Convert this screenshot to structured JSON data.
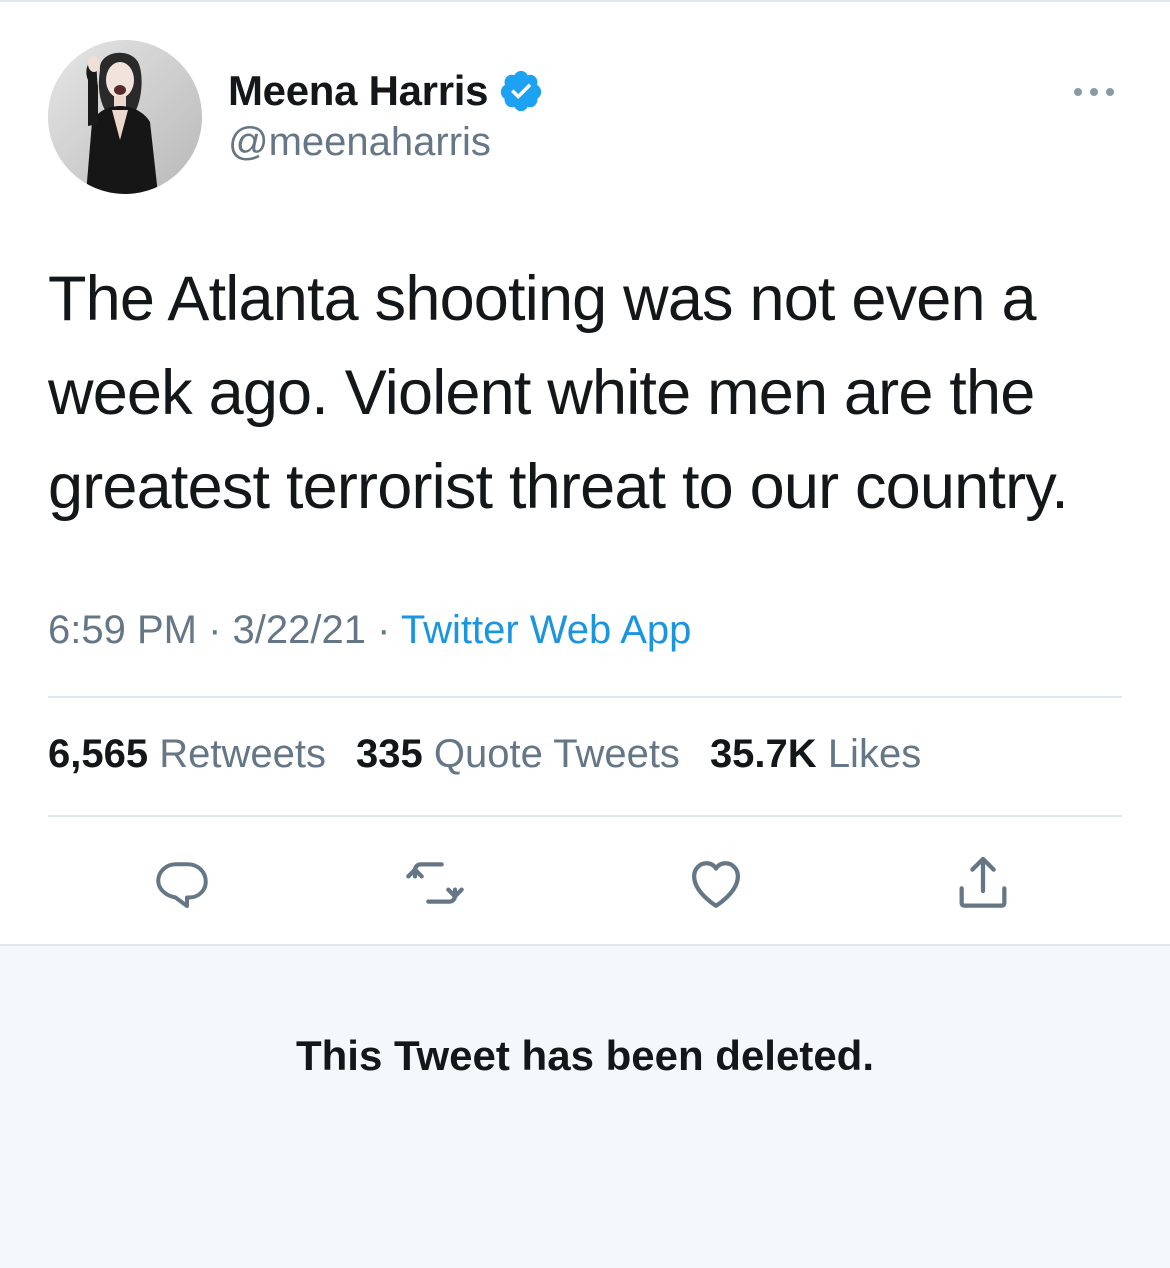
{
  "author": {
    "display_name": "Meena Harris",
    "handle": "@meenaharris",
    "verified": true
  },
  "tweet": {
    "text": "The Atlanta shooting was not even a\nweek ago. Violent white men are the\ngreatest terrorist threat to our country.",
    "time": "6:59 PM",
    "date": "3/22/21",
    "separator": "·",
    "source": "Twitter Web App"
  },
  "stats": {
    "retweets_count": "6,565",
    "retweets_label": "Retweets",
    "quotes_count": "335",
    "quotes_label": "Quote Tweets",
    "likes_count": "35.7K",
    "likes_label": "Likes"
  },
  "icons": {
    "verified": "verified-badge-icon",
    "more": "more-horizontal-icon",
    "reply": "reply-icon",
    "retweet": "retweet-icon",
    "like": "heart-icon",
    "share": "share-icon"
  },
  "colors": {
    "text_primary": "#14171a",
    "text_secondary": "#657786",
    "accent": "#1b95e0",
    "divider": "#e1e8ed",
    "deleted_bg": "#f5f8fa"
  },
  "quoted_tweet": {
    "status": "This Tweet has been deleted."
  }
}
